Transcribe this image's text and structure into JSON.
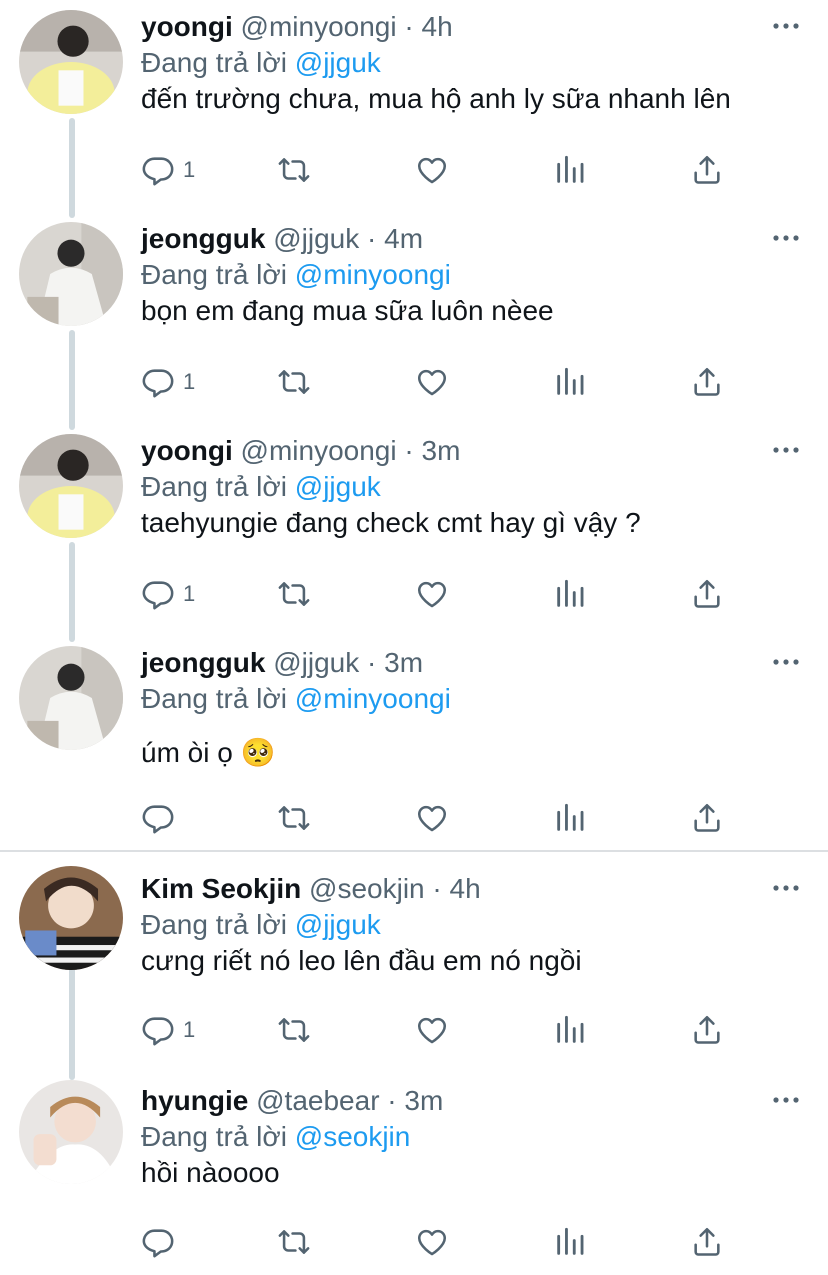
{
  "reply_prefix": "Đang trả lời",
  "tweets": [
    {
      "name": "yoongi",
      "handle": "@minyoongi",
      "dot": "·",
      "time": "4h",
      "reply_to": "@jjguk",
      "text": "đến trường chưa, mua hộ anh ly sữa nhanh lên",
      "reply_count": "1"
    },
    {
      "name": "jeongguk",
      "handle": "@jjguk",
      "dot": "·",
      "time": "4m",
      "reply_to": "@minyoongi",
      "text": "bọn em đang mua sữa luôn nèee",
      "reply_count": "1"
    },
    {
      "name": "yoongi",
      "handle": "@minyoongi",
      "dot": "·",
      "time": "3m",
      "reply_to": "@jjguk",
      "text": "taehyungie đang check cmt hay gì vậy ?",
      "reply_count": "1"
    },
    {
      "name": "jeongguk",
      "handle": "@jjguk",
      "dot": "·",
      "time": "3m",
      "reply_to": "@minyoongi",
      "text": "úm òi ọ 🥺",
      "reply_count": ""
    },
    {
      "name": "Kim Seokjin",
      "handle": "@seokjin",
      "dot": "·",
      "time": "4h",
      "reply_to": "@jjguk",
      "text": "cưng riết nó leo lên đầu em nó ngồi",
      "reply_count": "1"
    },
    {
      "name": "hyungie",
      "handle": "@taebear",
      "dot": "·",
      "time": "3m",
      "reply_to": "@seokjin",
      "text": "hồi nàoooo",
      "reply_count": ""
    }
  ],
  "colors": {
    "text": "#0f1419",
    "secondary": "#536471",
    "accent": "#1d9bf0",
    "thread_line": "#cfd9de"
  },
  "icons": [
    "reply-icon",
    "retweet-icon",
    "like-icon",
    "views-icon",
    "share-icon",
    "more-icon"
  ]
}
